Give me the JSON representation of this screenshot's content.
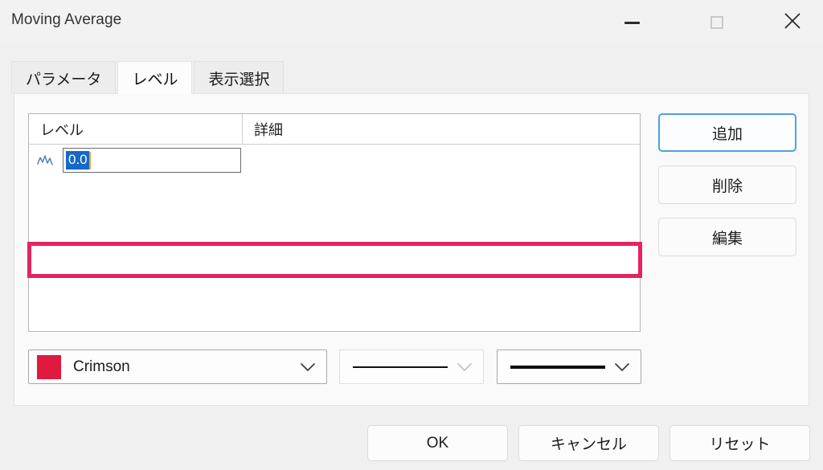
{
  "window": {
    "title": "Moving Average",
    "controls": {
      "minimize": "minimize-icon",
      "maximize": "maximize-icon",
      "close": "close-icon"
    }
  },
  "tabs": [
    {
      "label": "パラメータ",
      "active": false
    },
    {
      "label": "レベル",
      "active": true
    },
    {
      "label": "表示選択",
      "active": false
    }
  ],
  "list": {
    "columns": [
      {
        "label": "レベル"
      },
      {
        "label": "詳細"
      }
    ],
    "rows": [
      {
        "icon": "level-line-chart-icon",
        "value": "0.0",
        "detail": "",
        "selected": true,
        "editing": true
      }
    ]
  },
  "side_buttons": [
    {
      "label": "追加",
      "focused": true
    },
    {
      "label": "削除",
      "focused": false
    },
    {
      "label": "編集",
      "focused": false
    }
  ],
  "selects": {
    "color": {
      "value": "Crimson",
      "swatch": "#e0193f",
      "arrow": "chevron-down-icon"
    },
    "line_style": {
      "value": "solid-thin",
      "arrow": "chevron-down-icon"
    },
    "line_width": {
      "value": "solid-thick",
      "arrow": "chevron-down-icon"
    }
  },
  "footer_buttons": [
    {
      "label": "OK"
    },
    {
      "label": "キャンセル"
    },
    {
      "label": "リセット"
    }
  ],
  "colors": {
    "highlight_annotation": "#e5235e",
    "selection_blue": "#1668c8",
    "focus_blue": "#4aa3e0",
    "crimson": "#e0193f",
    "dialog_bg": "#f0f0f0",
    "panel_bg": "#fafafa"
  }
}
